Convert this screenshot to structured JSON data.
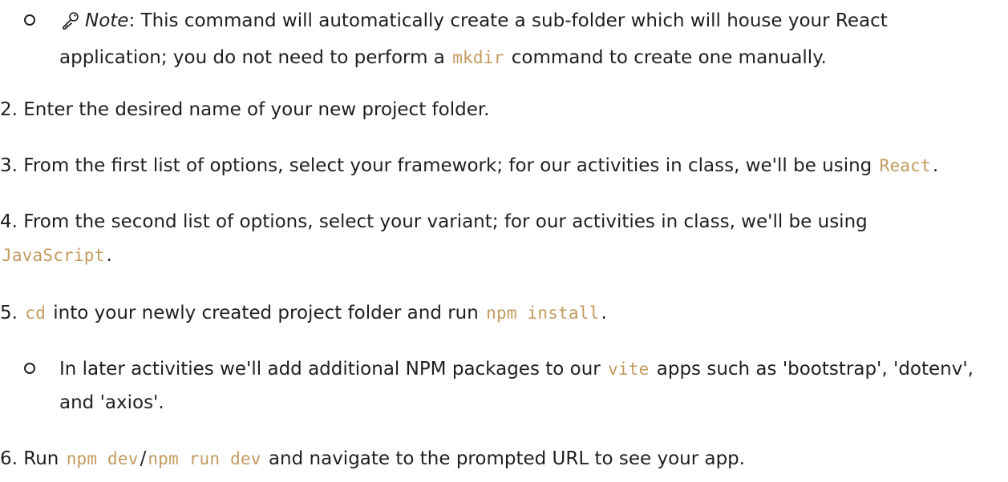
{
  "note_item": {
    "icon": "key-icon",
    "label": "Note",
    "text_a": ": This command will automatically create a sub-folder which will house your React application; you do not need to perform a ",
    "code": "mkdir",
    "text_b": " command to create one manually."
  },
  "steps": [
    {
      "num": "2.",
      "text": " Enter the desired name of your new project folder."
    },
    {
      "num": "3.",
      "text_a": " From the first list of options, select your framework; for our activities in class, we'll be using ",
      "code": "React",
      "text_b": "."
    },
    {
      "num": "4.",
      "text_a": " From the second list of options, select your variant; for our activities in class, we'll be using ",
      "code": "JavaScript",
      "text_b": "."
    },
    {
      "num": "5.",
      "code_a": "cd",
      "text_a": " into your newly created project folder and run ",
      "code_b": "npm install",
      "text_b": "."
    },
    {
      "num": "6.",
      "text_a": " Run ",
      "code_a": "npm dev",
      "sep": "/",
      "code_b": "npm run dev",
      "text_b": " and navigate to the prompted URL to see your app."
    }
  ],
  "later_item": {
    "text_a": "In later activities we'll add additional NPM packages to our ",
    "code": "vite",
    "text_b": " apps such as 'bootstrap', 'dotenv', and 'axios'."
  },
  "colors": {
    "code": "#c39a5e",
    "text": "#1f1f1f",
    "background": "#ffffff"
  }
}
